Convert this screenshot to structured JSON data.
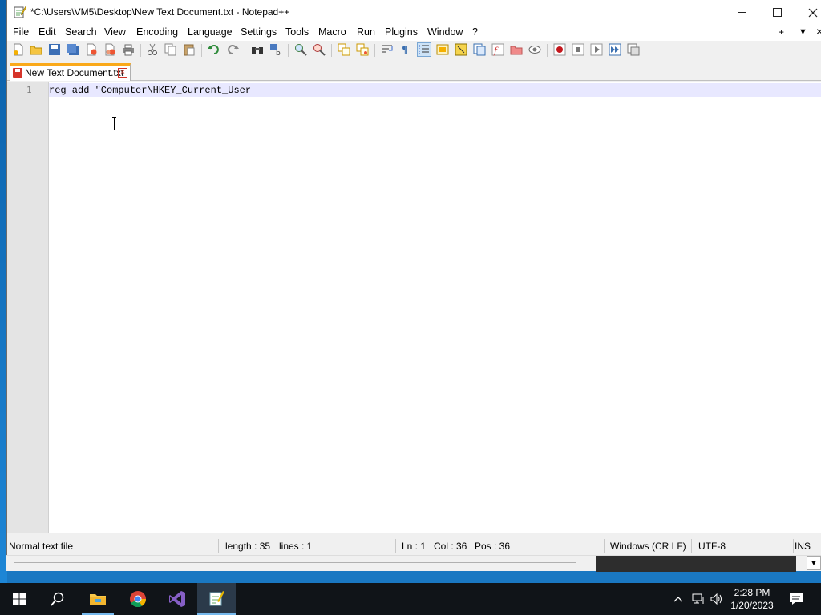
{
  "window": {
    "title": "*C:\\Users\\VM5\\Desktop\\New Text Document.txt - Notepad++"
  },
  "menu": [
    "File",
    "Edit",
    "Search",
    "View",
    "Encoding",
    "Language",
    "Settings",
    "Tools",
    "Macro",
    "Run",
    "Plugins",
    "Window",
    "?"
  ],
  "menu_right": {
    "add": "+",
    "dropdown": "▼",
    "close": "×"
  },
  "toolbar_icons": [
    "new-file-icon",
    "open-file-icon",
    "save-icon",
    "save-all-icon",
    "close-icon",
    "close-all-icon",
    "print-icon",
    "cut-icon",
    "copy-icon",
    "paste-icon",
    "undo-icon",
    "redo-icon",
    "find-icon",
    "replace-icon",
    "zoom-in-icon",
    "zoom-out-icon",
    "sync-vertical-icon",
    "sync-horizontal-icon",
    "word-wrap-icon",
    "show-all-chars-icon",
    "indent-guide-icon",
    "udl-icon",
    "doc-map-icon",
    "doc-list-icon",
    "function-list-icon",
    "folder-workspace-icon",
    "monitoring-icon",
    "record-macro-icon",
    "stop-macro-icon",
    "play-macro-icon",
    "run-macro-multiple-icon",
    "save-macro-icon"
  ],
  "tab": {
    "label": "New Text Document.txt"
  },
  "editor": {
    "line_number": "1",
    "line_text": "reg add \"Computer\\HKEY_Current_User"
  },
  "status": {
    "file_type": "Normal text file",
    "length": "length : 35",
    "lines": "lines : 1",
    "ln": "Ln : 1",
    "col": "Col : 36",
    "pos": "Pos : 36",
    "eol": "Windows (CR LF)",
    "encoding": "UTF-8",
    "mode": "INS"
  },
  "taskbar": {
    "time": "2:28 PM",
    "date": "1/20/2023"
  },
  "colors": {
    "tab_accent": "#faa91a",
    "current_line": "#e8e8ff",
    "taskbar": "#101418"
  }
}
